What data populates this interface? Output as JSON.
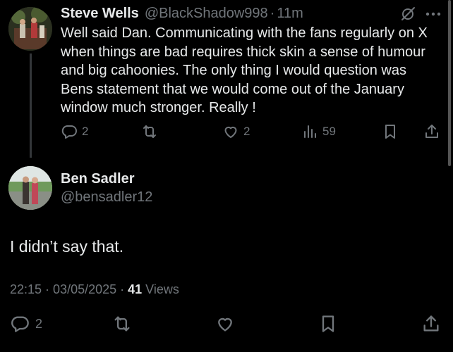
{
  "reply": {
    "display_name": "Steve Wells",
    "handle": "@BlackShadow998",
    "separator": "·",
    "time": "11m",
    "text": "Well said Dan. Communicating with the fans regularly on X when things are bad requires thick skin a sense of humour and big cahoonies. The only thing I would question was Bens statement that we would come out of the January window much stronger. Really !",
    "actions": {
      "replies": "2",
      "reposts": "",
      "likes": "2",
      "views": "59"
    },
    "icons": [
      "grok-icon",
      "more-icon",
      "reply-icon",
      "repost-icon",
      "like-icon",
      "views-icon",
      "bookmark-icon",
      "share-icon"
    ]
  },
  "main_tweet": {
    "display_name": "Ben Sadler",
    "handle": "@bensadler12",
    "text": "I didn’t say that.",
    "time": "22:15",
    "date": "03/05/2025",
    "separator": "·",
    "views_count": "41",
    "views_label": "Views",
    "actions": {
      "replies": "2"
    },
    "icons": [
      "reply-icon",
      "repost-icon",
      "like-icon",
      "bookmark-icon",
      "share-icon"
    ]
  },
  "colors": {
    "background": "#000000",
    "primary_text": "#e7e9ea",
    "secondary_text": "#71767b",
    "divider": "#333639"
  }
}
